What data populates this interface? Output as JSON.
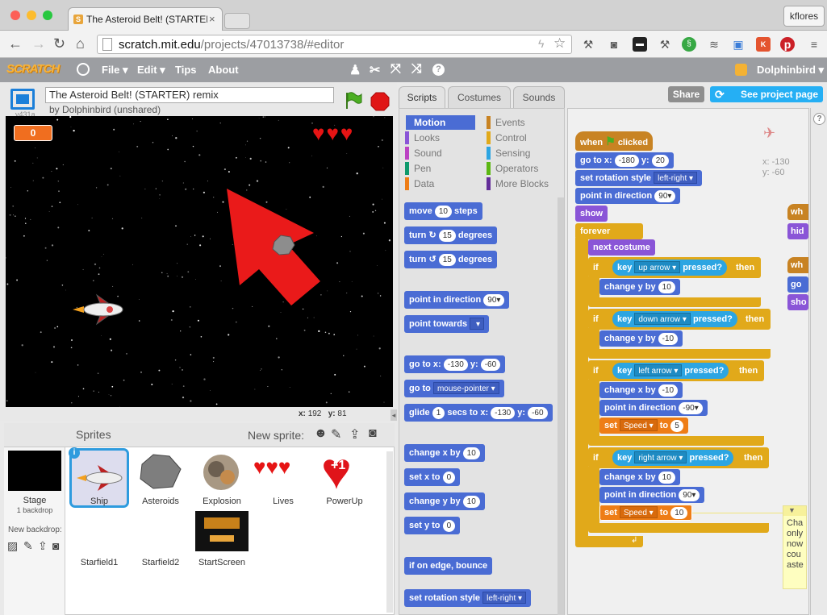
{
  "browser": {
    "tab_title": "The Asteroid Belt! (STARTER",
    "url_host": "scratch.mit.edu",
    "url_path": "/projects/47013738/#editor",
    "user_button": "kflores"
  },
  "menubar": {
    "logo": "SCRATCH",
    "file": "File",
    "edit": "Edit",
    "tips": "Tips",
    "about": "About",
    "username": "Dolphinbird"
  },
  "project": {
    "title": "The Asteroid Belt! (STARTER) remix",
    "author": "by Dolphinbird (unshared)",
    "version": "v431a",
    "score": "0",
    "coords_x_label": "x:",
    "coords_x": "192",
    "coords_y_label": "y:",
    "coords_y": "81"
  },
  "header_buttons": {
    "share": "Share",
    "see_project": "See project page"
  },
  "sprites": {
    "header": "Sprites",
    "new_sprite": "New sprite:",
    "stage_label": "Stage",
    "stage_sub": "1 backdrop",
    "new_backdrop": "New backdrop:",
    "items": [
      {
        "name": "Ship"
      },
      {
        "name": "Asteroids"
      },
      {
        "name": "Explosion"
      },
      {
        "name": "Lives"
      },
      {
        "name": "PowerUp"
      },
      {
        "name": "Starfield1"
      },
      {
        "name": "Starfield2"
      },
      {
        "name": "StartScreen"
      }
    ]
  },
  "tabs": {
    "scripts": "Scripts",
    "costumes": "Costumes",
    "sounds": "Sounds"
  },
  "categories": {
    "motion": "Motion",
    "looks": "Looks",
    "sound": "Sound",
    "pen": "Pen",
    "data": "Data",
    "events": "Events",
    "control": "Control",
    "sensing": "Sensing",
    "operators": "Operators",
    "more_blocks": "More Blocks"
  },
  "palette": {
    "move": "move",
    "move_val": "10",
    "steps": "steps",
    "turn": "turn",
    "turn_cw_val": "15",
    "turn_ccw_val": "15",
    "degrees": "degrees",
    "point_dir": "point in direction",
    "point_dir_val": "90▾",
    "point_towards": "point towards",
    "goto_xy": "go to x:",
    "goto_x": "-130",
    "goto_y_label": "y:",
    "goto_y": "-60",
    "goto": "go to",
    "goto_target": "mouse-pointer ▾",
    "glide": "glide",
    "glide_secs": "1",
    "glide_secs_label": "secs to x:",
    "glide_x": "-130",
    "glide_y_label": "y:",
    "glide_y": "-60",
    "change_x": "change x by",
    "change_x_val": "10",
    "set_x": "set x to",
    "set_x_val": "0",
    "change_y": "change y by",
    "change_y_val": "10",
    "set_y": "set y to",
    "set_y_val": "0",
    "bounce": "if on edge, bounce",
    "rotation": "set rotation style",
    "rotation_val": "left-right ▾"
  },
  "script": {
    "when_clicked_a": "when",
    "when_clicked_b": "clicked",
    "goto_xy": "go to x:",
    "goto_x": "-180",
    "goto_y_label": "y:",
    "goto_y": "20",
    "rotation": "set rotation style",
    "rotation_val": "left-right ▾",
    "point_dir": "point in direction",
    "point_dir_val": "90▾",
    "show": "show",
    "forever": "forever",
    "next_costume": "next costume",
    "if": "if",
    "key": "key",
    "pressed": "pressed?",
    "then": "then",
    "up_arrow": "up arrow ▾",
    "down_arrow": "down arrow ▾",
    "left_arrow": "left arrow ▾",
    "right_arrow": "right arrow ▾",
    "change_y": "change y by",
    "up_val": "10",
    "down_val": "-10",
    "change_x": "change x by",
    "left_val": "-10",
    "right_val": "10",
    "point_dir_left": "-90▾",
    "point_dir_right": "90▾",
    "set": "set",
    "speed_var": "Speed ▾",
    "to": "to",
    "speed_left": "5",
    "speed_right": "10",
    "sprite_x_label": "x:",
    "sprite_x": "-130",
    "sprite_y_label": "y:",
    "sprite_y": "-60",
    "frag1": "wh",
    "frag2": "hid",
    "frag3": "wh",
    "frag4": "go",
    "frag5": "sho",
    "comment": "Cha\nonly\nnow\ncou\naste"
  },
  "colors": {
    "motion": "#4a6cd4",
    "looks": "#8a55d7",
    "events": "#c88323",
    "control": "#e1a91a",
    "sensing": "#2ca5e2",
    "data": "#ee7d16"
  }
}
